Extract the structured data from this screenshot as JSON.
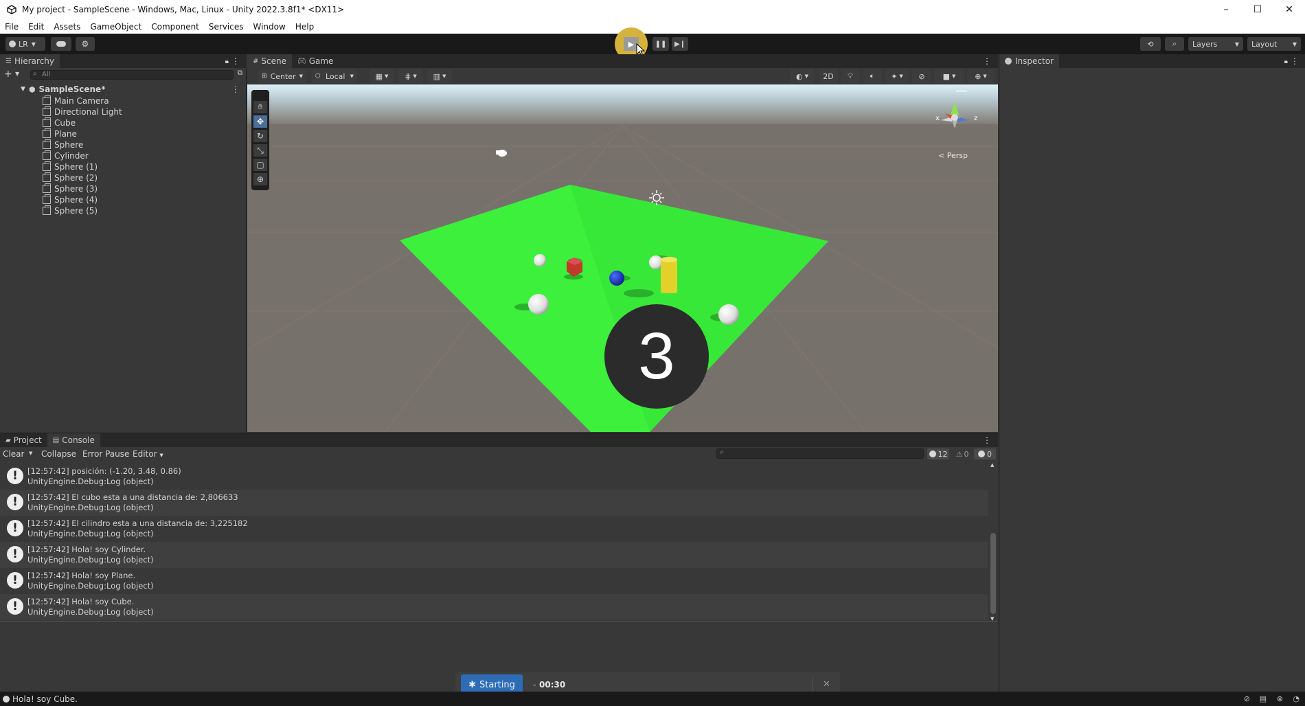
{
  "window": {
    "title": "My project - SampleScene - Windows, Mac, Linux - Unity 2022.3.8f1* <DX11>",
    "minimize": "–",
    "maximize": "☐",
    "close": "✕"
  },
  "menu": [
    "File",
    "Edit",
    "Assets",
    "GameObject",
    "Component",
    "Services",
    "Window",
    "Help"
  ],
  "toolbar": {
    "account": "LR",
    "layers": "Layers",
    "layout": "Layout"
  },
  "hierarchy": {
    "tab": "Hierarchy",
    "search_placeholder": "All",
    "scene": "SampleScene*",
    "items": [
      "Main Camera",
      "Directional Light",
      "Cube",
      "Plane",
      "Sphere",
      "Cylinder",
      "Sphere (1)",
      "Sphere (2)",
      "Sphere (3)",
      "Sphere (4)",
      "Sphere (5)"
    ]
  },
  "scene": {
    "tabs": [
      "Scene",
      "Game"
    ],
    "pivot": "Center",
    "space": "Local",
    "mode_2d": "2D",
    "persp": "Persp",
    "gizmo_x": "x",
    "gizmo_z": "z",
    "countdown": "3"
  },
  "inspector": {
    "tab": "Inspector"
  },
  "bottom": {
    "tabs": [
      "Project",
      "Console"
    ],
    "toolbar": {
      "clear": "Clear",
      "collapse": "Collapse",
      "error_pause": "Error Pause",
      "editor": "Editor"
    },
    "counts": {
      "info": "12",
      "warn": "0",
      "error": "0"
    },
    "logs": [
      {
        "line1": "[12:57:42] posición: (-1.20, 3.48, 0.86)",
        "line2": "UnityEngine.Debug:Log (object)"
      },
      {
        "line1": "[12:57:42] El cubo esta a una distancia de: 2,806633",
        "line2": "UnityEngine.Debug:Log (object)"
      },
      {
        "line1": "[12:57:42] El cilindro esta a una distancia de: 3,225182",
        "line2": "UnityEngine.Debug:Log (object)"
      },
      {
        "line1": "[12:57:42] Hola! soy Cylinder.",
        "line2": "UnityEngine.Debug:Log (object)"
      },
      {
        "line1": "[12:57:42] Hola! soy Plane.",
        "line2": "UnityEngine.Debug:Log (object)"
      },
      {
        "line1": "[12:57:42] Hola! soy Cube.",
        "line2": "UnityEngine.Debug:Log (object)"
      }
    ]
  },
  "recorder": {
    "label": "Starting",
    "time": "00:30",
    "separator": "-",
    "close": "✕"
  },
  "status": {
    "message": "Hola! soy Cube."
  },
  "colors": {
    "plane": "#3cf03c",
    "ground": "#77716b",
    "cube": "#c0392b",
    "blue_sphere": "#1d3fd0",
    "cylinder": "#e3d02a",
    "play_highlight": "#d5b23a"
  }
}
